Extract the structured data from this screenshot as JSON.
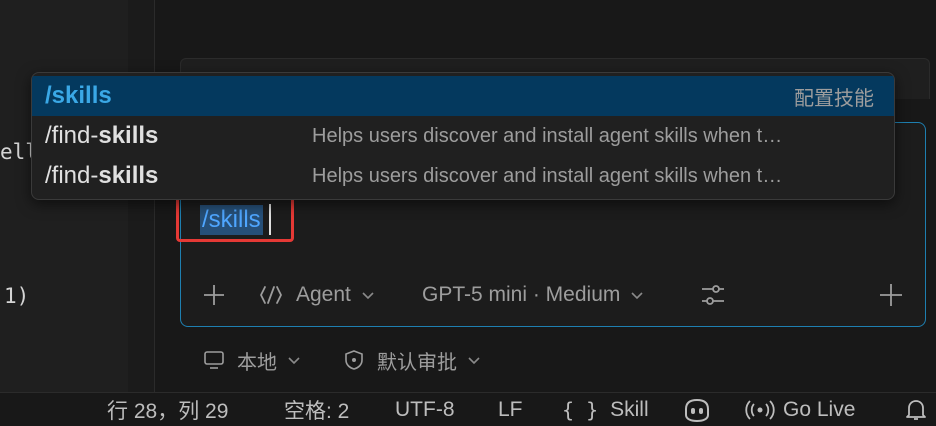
{
  "editor": {
    "fragments": [
      "ell",
      "1)"
    ]
  },
  "popup": {
    "items": [
      {
        "command": "/skills",
        "hint": "配置技能",
        "selected": true
      },
      {
        "prefix": "/find-",
        "bold": "skills",
        "description": "Helps users discover and install agent skills when t…"
      },
      {
        "prefix": "/find-",
        "bold": "skills",
        "description": "Helps users discover and install agent skills when t…"
      }
    ]
  },
  "input": {
    "typed": "/skills"
  },
  "toolbar": {
    "mode_label": "Agent",
    "model_label": "GPT-5 mini · Medium",
    "icons": [
      "plus-icon",
      "agent-icon",
      "chevron-down-icon",
      "settings-sliders-icon",
      "plus-icon"
    ]
  },
  "sub": {
    "location_label": "本地",
    "approval_label": "默认审批"
  },
  "statusbar": {
    "cursor": "行 28，列 29",
    "spaces": "空格: 2",
    "encoding": "UTF-8",
    "eol": "LF",
    "language": "Skill",
    "golive": "Go Live"
  },
  "colors": {
    "accent": "#1e7fb0",
    "selection_bg": "#04395e",
    "highlight_border": "#e53935",
    "command_blue": "#3aa8e6"
  }
}
